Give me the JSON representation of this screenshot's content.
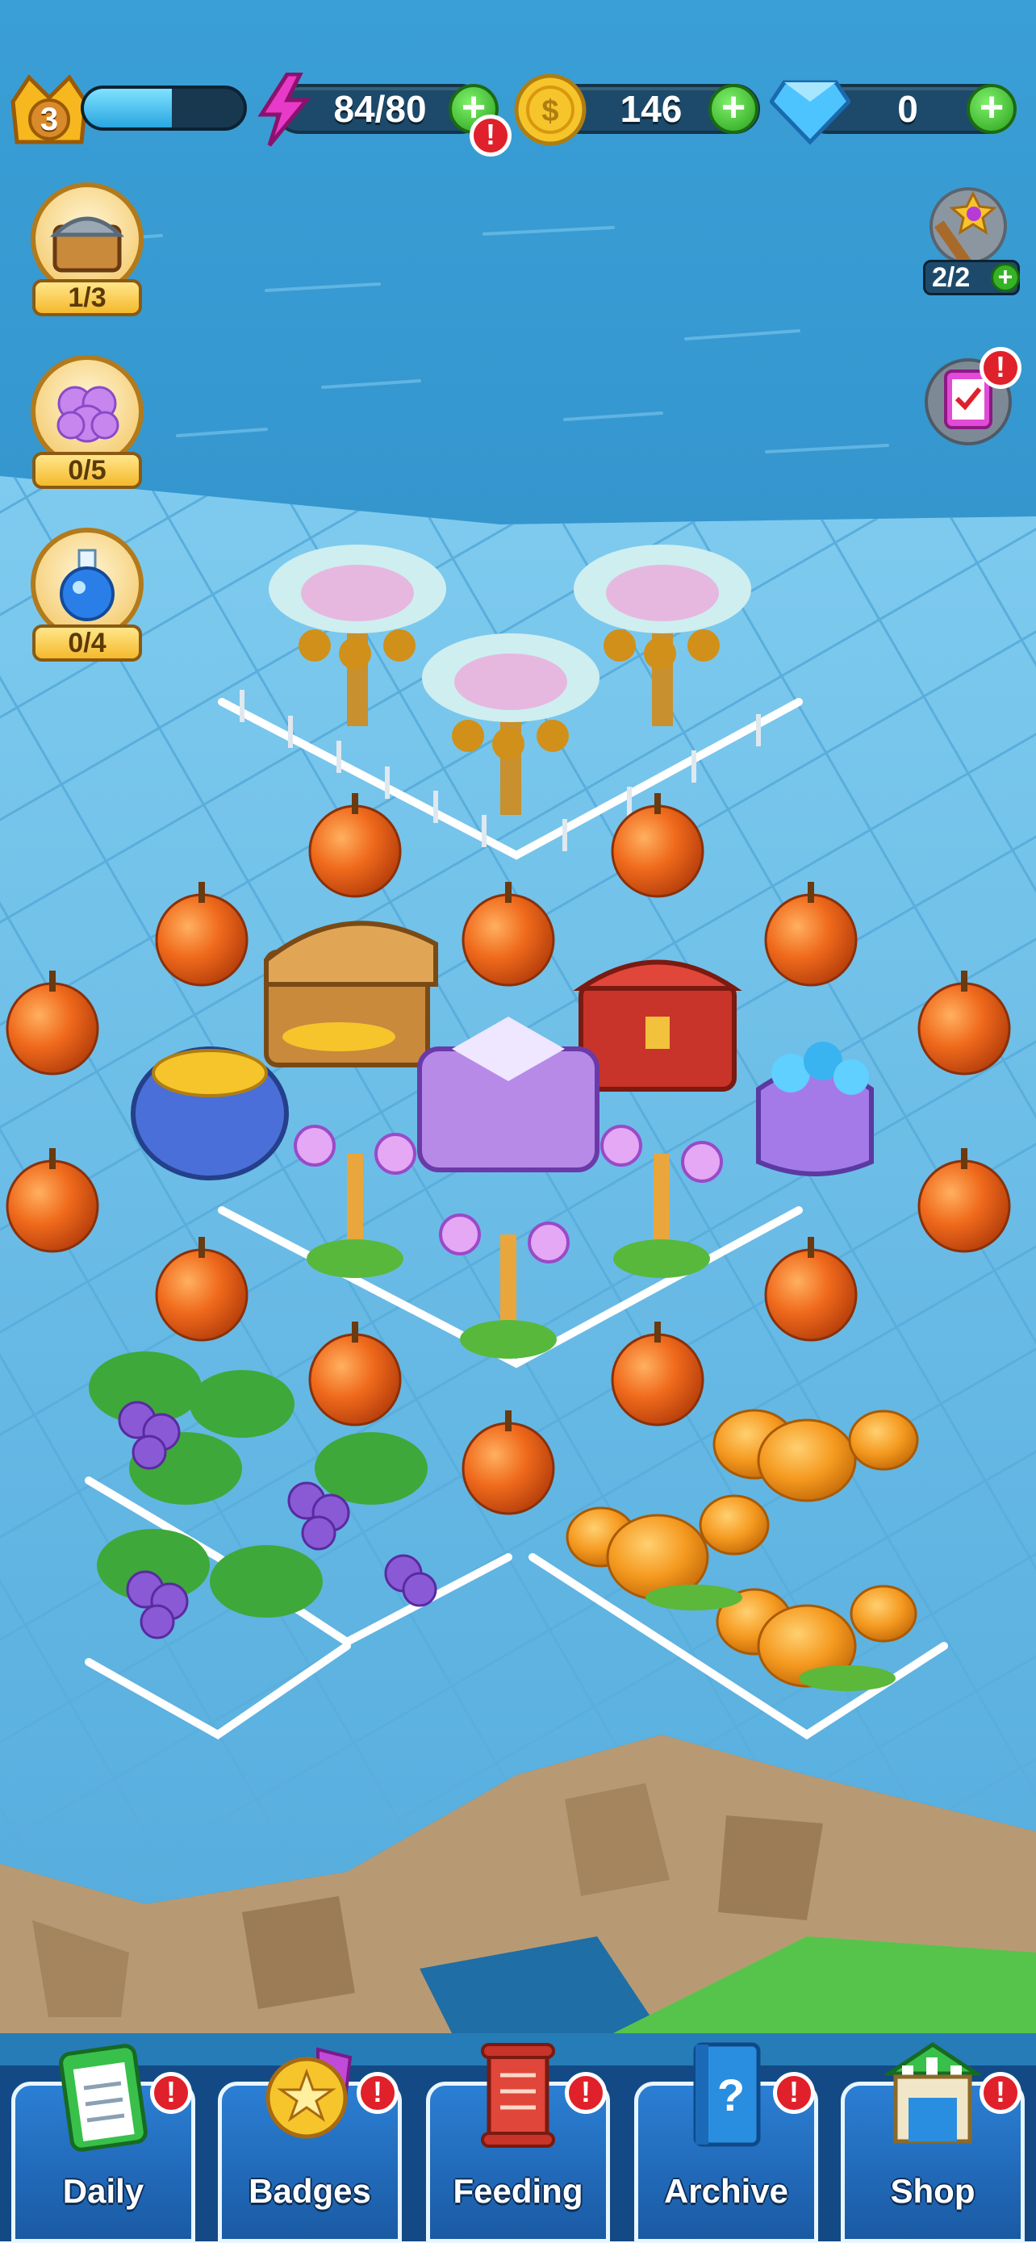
{
  "hud": {
    "level": "3",
    "xp_progress": 0.55,
    "energy": "84/80",
    "coins": "146",
    "gems": "0"
  },
  "side_buttons": [
    {
      "name": "chest",
      "count": "1/3"
    },
    {
      "name": "flower",
      "count": "0/5"
    },
    {
      "name": "potion",
      "count": "0/4"
    }
  ],
  "wand": {
    "count": "2/2"
  },
  "nav": [
    {
      "label": "Daily"
    },
    {
      "label": "Badges"
    },
    {
      "label": "Feeding"
    },
    {
      "label": "Archive"
    },
    {
      "label": "Shop"
    }
  ],
  "colors": {
    "sea": "#2e8fc8",
    "ice_tile": "#6cc0ea",
    "fence": "#f2f7fb",
    "apple": "#f06a1c",
    "pumpkin": "#f59a20",
    "grape": "#8a5ad6",
    "nav_blue": "#1f6ec0",
    "alert_red": "#e0202a",
    "plus_green": "#35b225"
  }
}
